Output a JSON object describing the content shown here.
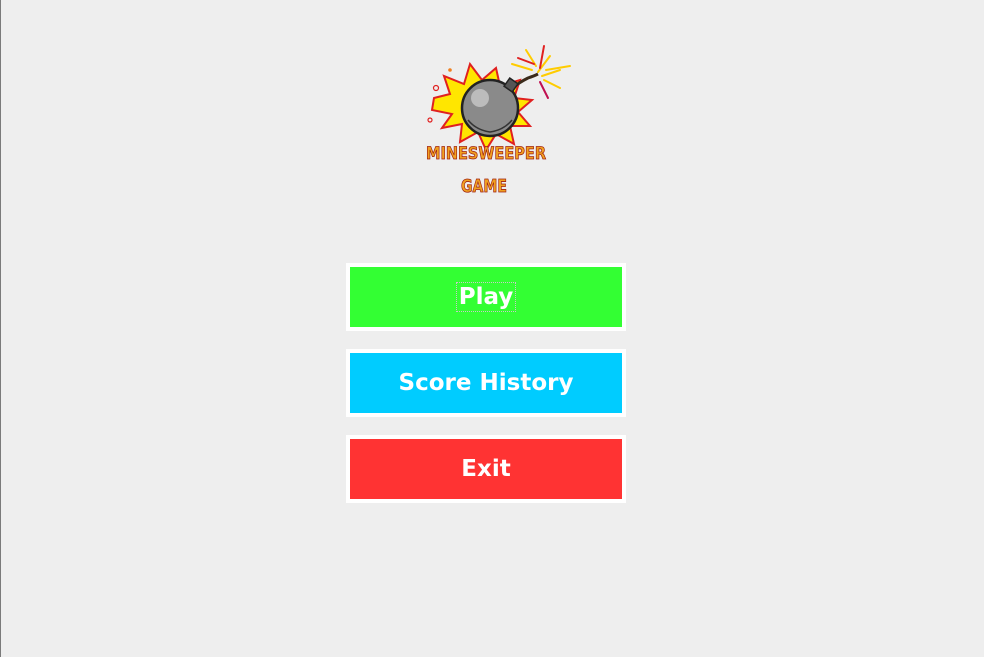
{
  "logo": {
    "title_line1": "MINESWEEPER",
    "title_line2": "GAME",
    "icon": "bomb-icon",
    "colors": {
      "burst": "#ffe600",
      "burst_outline": "#e02020",
      "bomb": "#8a8a8a",
      "text_fill": "#f0a020",
      "text_outline": "#a02010"
    }
  },
  "menu": {
    "buttons": [
      {
        "label": "Play",
        "color": "#33ff33"
      },
      {
        "label": "Score History",
        "color": "#00ccff"
      },
      {
        "label": "Exit",
        "color": "#ff3333"
      }
    ]
  }
}
